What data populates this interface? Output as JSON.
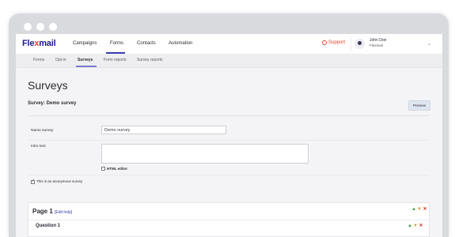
{
  "app": {
    "logo_prefix": "Fle",
    "logo_x": "x",
    "logo_suffix": "mail"
  },
  "topnav": {
    "items": [
      {
        "label": "Campaigns"
      },
      {
        "label": "Forms",
        "active": true
      },
      {
        "label": "Contacts"
      },
      {
        "label": "Automation"
      }
    ],
    "support_label": "Support",
    "user_name": "John Doe",
    "user_org": "Flexmail"
  },
  "subnav": {
    "items": [
      {
        "label": "Forms"
      },
      {
        "label": "Opt-in"
      },
      {
        "label": "Surveys",
        "active": true
      },
      {
        "label": "Form reports"
      },
      {
        "label": "Survey reports"
      }
    ]
  },
  "page": {
    "title": "Surveys",
    "survey_label": "Survey: Demo survey",
    "preview_button": "Preview"
  },
  "form": {
    "name_label": "Name survey",
    "name_value": "Demo survey",
    "intro_label": "Intro text",
    "intro_value": "",
    "html_editor_label": "HTML editor",
    "html_editor_checked": false,
    "anonymous_label": "This is an anonymous survey",
    "anonymous_checked": true
  },
  "survey_page": {
    "title": "Page 1",
    "edit_help": "[Edit help]",
    "question_title": "Question 1"
  },
  "colors": {
    "brand": "#1e1a8c",
    "brand_accent": "#e4422e",
    "support": "#e4422e",
    "link": "#3b3bb0"
  },
  "icons": {
    "support": "lifebuoy-icon",
    "avatar": "user-icon",
    "caret": "chevron-down-icon",
    "move_up": "arrow-up-icon",
    "move_down": "arrow-down-icon",
    "delete": "close-icon"
  }
}
